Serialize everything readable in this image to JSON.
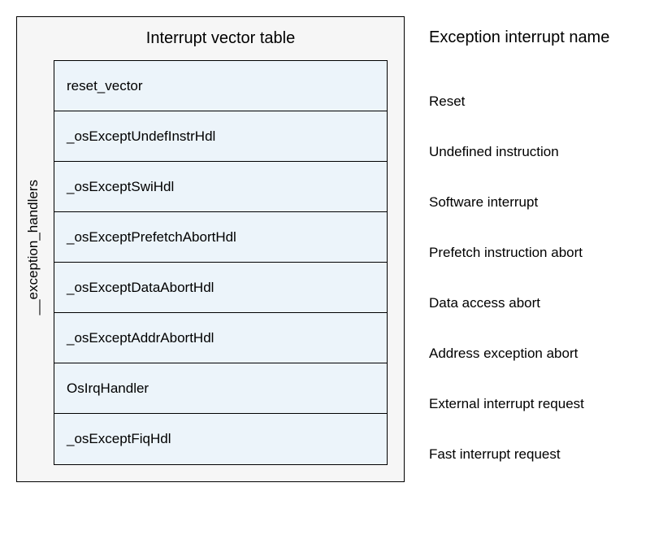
{
  "diagram": {
    "outer_label": "__exception_handlers",
    "table_title": "Interrupt vector table",
    "labels_header": "Exception interrupt name",
    "vectors": [
      {
        "handler": "reset_vector",
        "name": "Reset"
      },
      {
        "handler": "_osExceptUndefInstrHdl",
        "name": "Undefined instruction"
      },
      {
        "handler": "_osExceptSwiHdl",
        "name": "Software interrupt"
      },
      {
        "handler": "_osExceptPrefetchAbortHdl",
        "name": "Prefetch instruction abort"
      },
      {
        "handler": "_osExceptDataAbortHdl",
        "name": "Data access abort"
      },
      {
        "handler": "_osExceptAddrAbortHdl",
        "name": "Address exception abort"
      },
      {
        "handler": "OsIrqHandler",
        "name": "External interrupt request"
      },
      {
        "handler": "_osExceptFiqHdl",
        "name": "Fast interrupt request"
      }
    ]
  }
}
